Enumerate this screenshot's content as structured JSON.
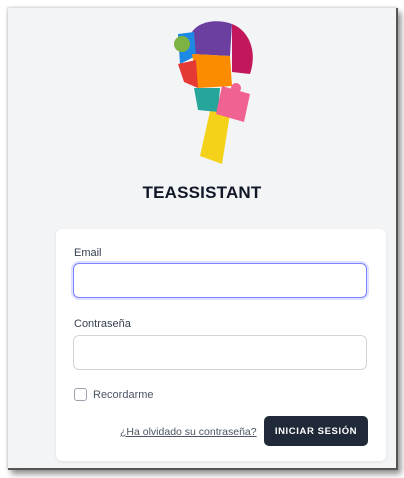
{
  "app": {
    "title": "TEASSISTANT"
  },
  "form": {
    "email_label": "Email",
    "email_value": "",
    "password_label": "Contraseña",
    "password_value": "",
    "remember_label": "Recordarme",
    "remember_checked": false,
    "forgot_link": "¿Ha olvidado su contraseña?",
    "submit_label": "INICIAR SESIÓN"
  },
  "colors": {
    "primary_button": "#1f2937",
    "focus_ring": "#7c83ff",
    "background": "#f3f4f6"
  }
}
